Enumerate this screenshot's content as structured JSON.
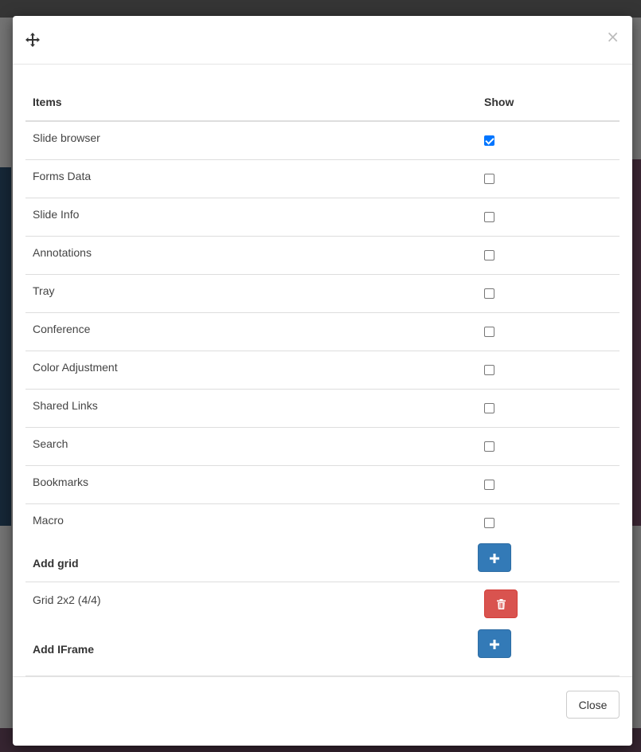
{
  "modal": {
    "close_glyph": "×",
    "table": {
      "headers": {
        "items": "Items",
        "show": "Show"
      },
      "rows": [
        {
          "label": "Slide browser",
          "checked": true
        },
        {
          "label": "Forms Data",
          "checked": false
        },
        {
          "label": "Slide Info",
          "checked": false
        },
        {
          "label": "Annotations",
          "checked": false
        },
        {
          "label": "Tray",
          "checked": false
        },
        {
          "label": "Conference",
          "checked": false
        },
        {
          "label": "Color Adjustment",
          "checked": false
        },
        {
          "label": "Shared Links",
          "checked": false
        },
        {
          "label": "Search",
          "checked": false
        },
        {
          "label": "Bookmarks",
          "checked": false
        },
        {
          "label": "Macro",
          "checked": false
        }
      ]
    },
    "add_grid": {
      "label": "Add grid",
      "icon": "plus-icon"
    },
    "grids": [
      {
        "label": "Grid 2x2 (4/4)",
        "icon": "trash-icon"
      }
    ],
    "add_iframe": {
      "label": "Add IFrame",
      "icon": "plus-icon"
    },
    "footer": {
      "close_label": "Close"
    }
  },
  "colors": {
    "primary": "#337ab7",
    "danger": "#d9534f",
    "checkbox_checked": "#0075ff"
  }
}
